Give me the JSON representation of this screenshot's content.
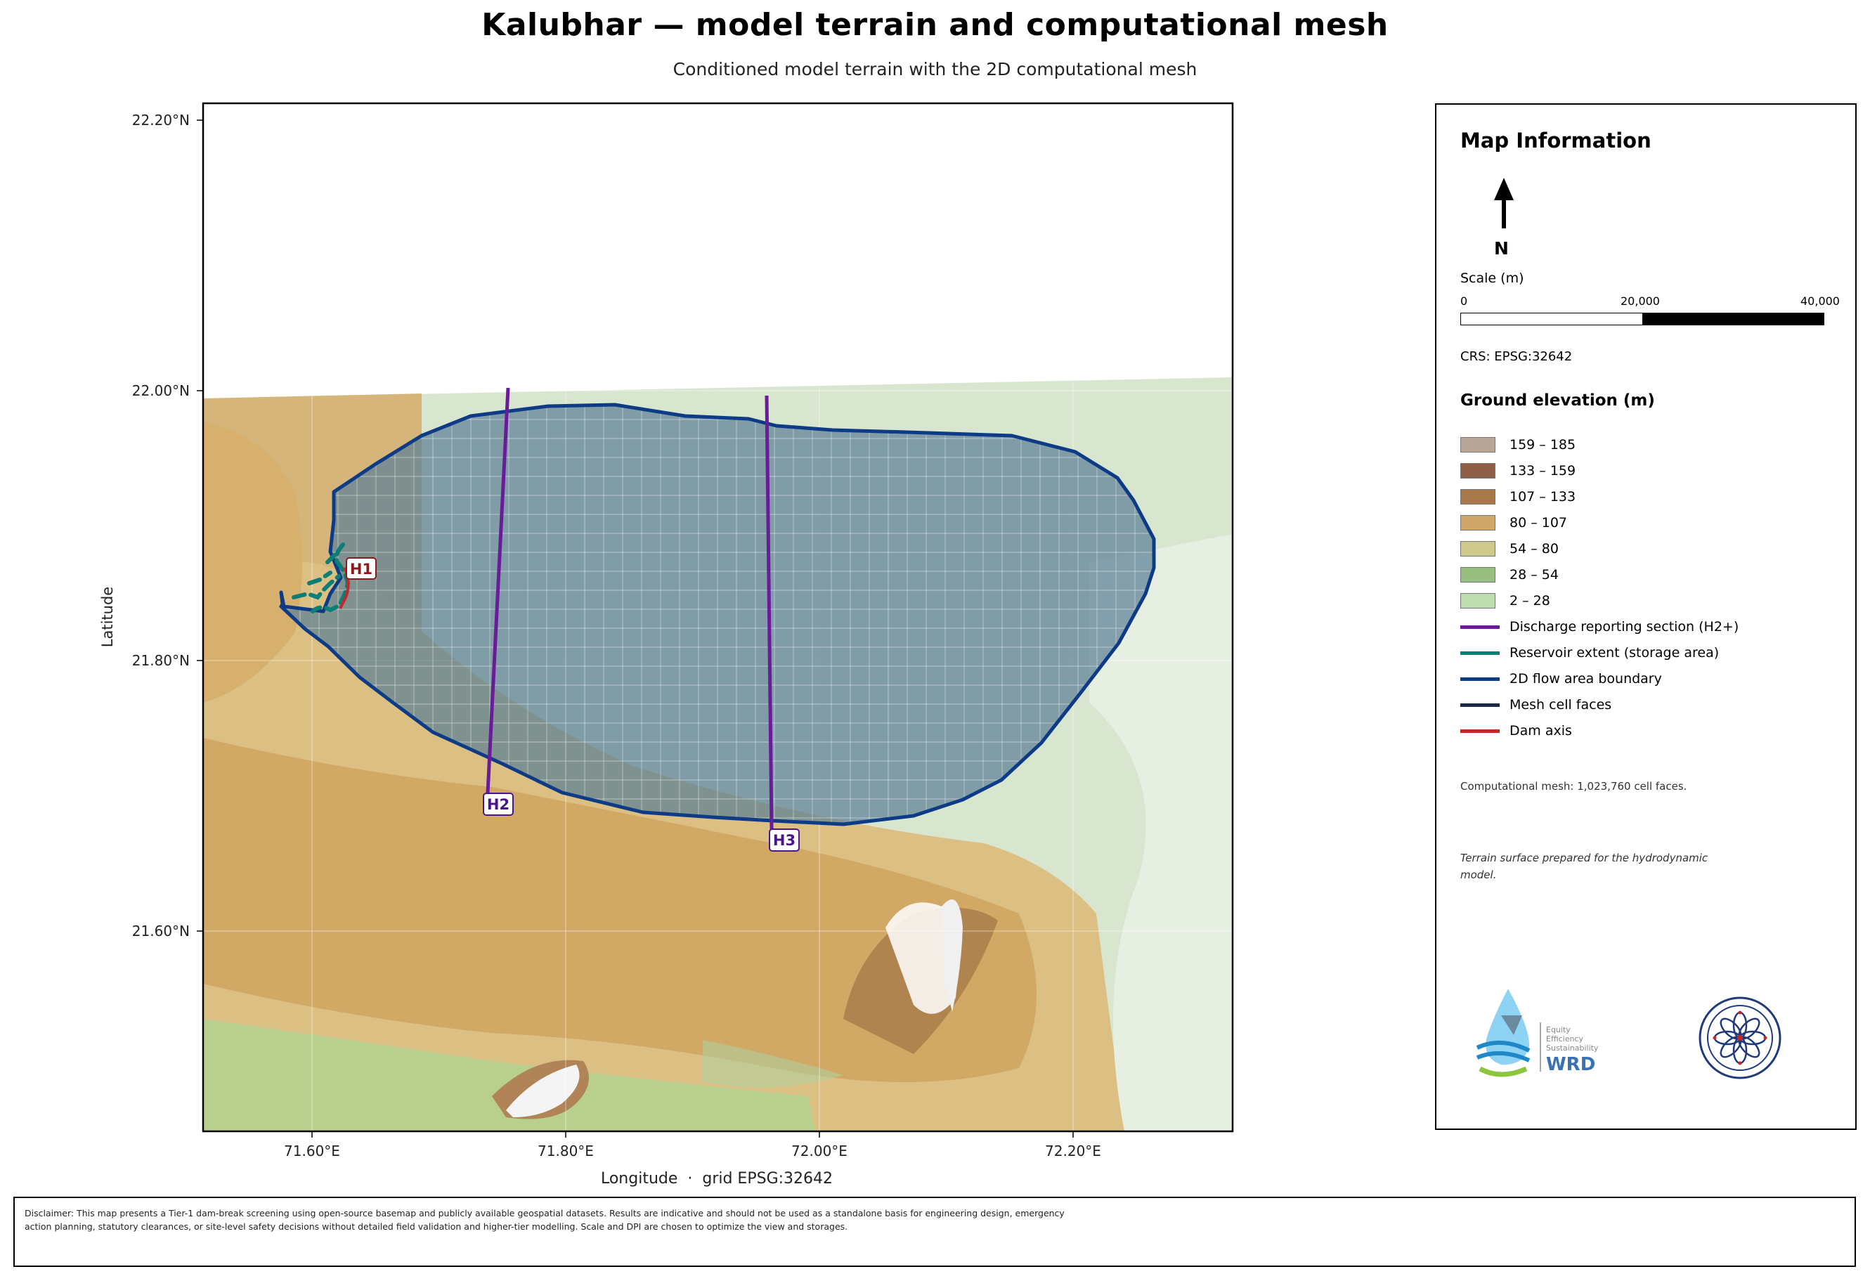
{
  "title": "Kalubhar — model terrain and computational mesh",
  "subtitle": "Conditioned model terrain with the 2D computational mesh",
  "map": {
    "y_axis_label": "Latitude",
    "x_axis_label": "Longitude  ·  grid EPSG:32642",
    "lat_ticks": [
      "22.20°N",
      "22.00°N",
      "21.80°N",
      "21.60°N"
    ],
    "lon_ticks": [
      "71.60°E",
      "71.80°E",
      "72.00°E",
      "72.20°E"
    ],
    "section_labels": {
      "h1": "H1",
      "h2": "H2",
      "h3": "H3"
    }
  },
  "legend": {
    "heading": "Map Information",
    "north": "N",
    "scale_title": "Scale (m)",
    "scale_ticks": [
      "0",
      "20,000",
      "40,000"
    ],
    "crs": "CRS: EPSG:32642",
    "elevation_title": "Ground elevation (m)",
    "elevation_classes": [
      {
        "label": "159 – 185",
        "color": "#b9a69b"
      },
      {
        "label": "133 – 159",
        "color": "#8e5e46"
      },
      {
        "label": "107 – 133",
        "color": "#a8784a"
      },
      {
        "label": "80 – 107",
        "color": "#cfa76a"
      },
      {
        "label": "54 – 80",
        "color": "#cdc98c"
      },
      {
        "label": "28 – 54",
        "color": "#98be80"
      },
      {
        "label": "2 – 28",
        "color": "#bfdcb0"
      }
    ],
    "line_items": [
      {
        "label": "Discharge reporting section (H2+)",
        "color": "#6a1b9a"
      },
      {
        "label": "Reservoir extent (storage area)",
        "color": "#0b7f74"
      },
      {
        "label": "2D flow area boundary",
        "color": "#0d3b86"
      },
      {
        "label": "Mesh cell faces",
        "color": "#1a2a44"
      },
      {
        "label": "Dam axis",
        "color": "#c62828"
      }
    ],
    "mesh_note": "Computational mesh: 1,023,760 cell faces.",
    "terrain_note": "Terrain surface prepared for the hydrodynamic model."
  },
  "logos": {
    "wrd_tagline": [
      "Equity",
      "Efficiency",
      "Sustainability"
    ],
    "wrd_text": "WRD"
  },
  "disclaimer": "Disclaimer: This map presents a Tier-1 dam-break screening using open-source basemap and publicly available geospatial datasets. Results are indicative and should not be used as a standalone basis for engineering design, emergency action planning, statutory clearances, or site-level safety decisions without detailed field validation and higher-tier modelling. Scale and DPI are chosen to optimize the view and storages."
}
